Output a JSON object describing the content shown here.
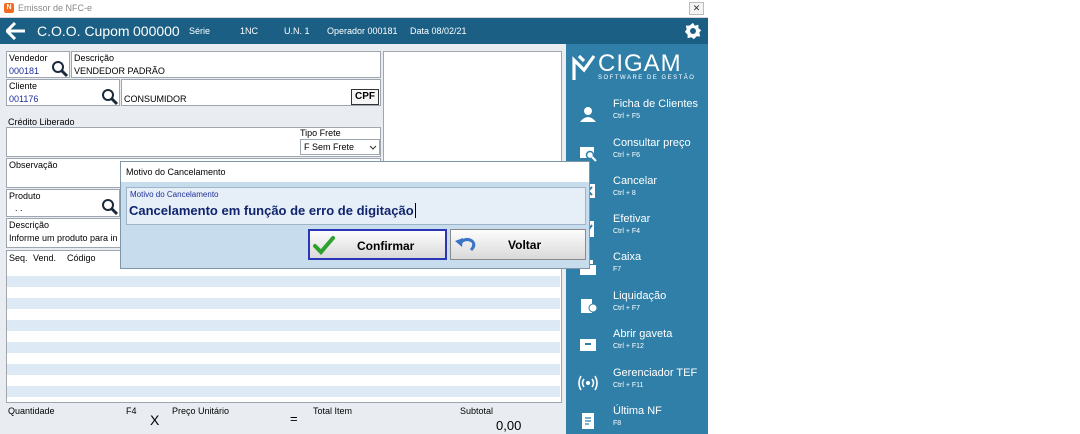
{
  "window": {
    "title": "Emissor de NFC-e",
    "close_glyph": "✕"
  },
  "header": {
    "back_glyph": "🡐",
    "coo_label": "C.O.O. Cupom",
    "coo_number": "000000",
    "serie_label": "Série",
    "serie_value": "1NC",
    "un": "U.N. 1",
    "operador": "Operador 000181",
    "data": "Data  08/02/21"
  },
  "form": {
    "vendedor_label": "Vendedor",
    "vendedor_code": "000181",
    "descricao_label": "Descrição",
    "vendedor_desc": "VENDEDOR PADRÃO",
    "cliente_label": "Cliente",
    "cliente_code": "001176",
    "cliente_name": "CONSUMIDOR",
    "cpf_button": "CPF",
    "credito_label": "Crédito Liberado",
    "tipo_frete_label": "Tipo Frete",
    "tipo_frete_value": "F Sem Frete",
    "observacao_label": "Observação",
    "produto_label": "Produto",
    "produto_value": ". .",
    "descricao2_label": "Descrição",
    "descricao2_value": "Informe um produto para in",
    "table_headers": [
      "Seq.",
      "Vend.",
      "Código"
    ],
    "quantidade_label": "Quantidade",
    "f4_label": "F4",
    "x_symbol": "X",
    "preco_label": "Preço Unitário",
    "eq_symbol": "=",
    "total_item_label": "Total Item",
    "subtotal_label": "Subtotal",
    "subtotal_value": "0,00"
  },
  "dialog": {
    "title": "Motivo do Cancelamento",
    "field_label": "Motivo do Cancelamento",
    "field_value": "Cancelamento em função de erro de digitação",
    "confirm_label": "Confirmar",
    "back_label": "Voltar"
  },
  "sidebar": {
    "logo_text": "CIGAM",
    "logo_sub": "SOFTWARE DE GESTÃO",
    "items": [
      {
        "label": "Ficha de Clientes",
        "shortcut": "Ctrl + F5",
        "icon": "customer-card-icon"
      },
      {
        "label": "Consultar preço",
        "shortcut": "Ctrl + F6",
        "icon": "price-search-icon"
      },
      {
        "label": "Cancelar",
        "shortcut": "Ctrl + 8",
        "icon": "cancel-icon"
      },
      {
        "label": "Efetivar",
        "shortcut": "Ctrl + F4",
        "icon": "confirm-sale-icon"
      },
      {
        "label": "Caixa",
        "shortcut": "F7",
        "icon": "cash-register-icon"
      },
      {
        "label": "Liquidação",
        "shortcut": "Ctrl + F7",
        "icon": "payment-icon"
      },
      {
        "label": "Abrir gaveta",
        "shortcut": "Ctrl + F12",
        "icon": "drawer-icon"
      },
      {
        "label": "Gerenciador TEF",
        "shortcut": "Ctrl + F11",
        "icon": "tef-signal-icon"
      },
      {
        "label": "Última NF",
        "shortcut": "F8",
        "icon": "last-invoice-icon"
      }
    ]
  },
  "colors": {
    "header": "#1b5f85",
    "sidebar": "#2f7fa8",
    "dialog_bg": "#c7dcec",
    "link_blue": "#1e2f9a"
  }
}
